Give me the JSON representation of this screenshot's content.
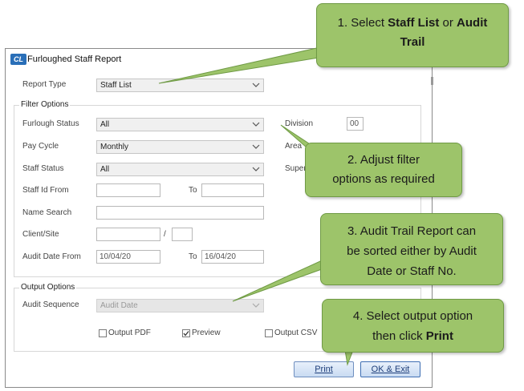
{
  "window": {
    "logo": "CL",
    "title": "Furloughed Staff Report"
  },
  "report_type": {
    "label": "Report Type",
    "value": "Staff List"
  },
  "filter_options": {
    "group_label": "Filter Options",
    "furlough_status": {
      "label": "Furlough Status",
      "value": "All"
    },
    "pay_cycle": {
      "label": "Pay Cycle",
      "value": "Monthly"
    },
    "staff_status": {
      "label": "Staff Status",
      "value": "All"
    },
    "staff_id_from": {
      "label": "Staff Id From",
      "value": ""
    },
    "staff_id_to": {
      "label": "To",
      "value": ""
    },
    "name_search": {
      "label": "Name Search",
      "value": ""
    },
    "client_site": {
      "label": "Client/Site",
      "value": "",
      "separator": "/",
      "site_value": ""
    },
    "audit_date_from": {
      "label": "Audit Date From",
      "value": "10/04/20"
    },
    "audit_date_to": {
      "label": "To",
      "value": "16/04/20"
    },
    "division": {
      "label": "Division",
      "value": "00"
    },
    "area": {
      "label": "Area"
    },
    "supervisor": {
      "label": "Super"
    }
  },
  "output_options": {
    "group_label": "Output Options",
    "audit_sequence": {
      "label": "Audit Sequence",
      "value": "Audit Date"
    },
    "output_pdf": {
      "label": "Output PDF",
      "checked": false
    },
    "preview": {
      "label": "Preview",
      "checked": true
    },
    "output_csv": {
      "label": "Output CSV",
      "checked": false
    }
  },
  "buttons": {
    "print": "Print",
    "ok_exit": "OK & Exit"
  },
  "callouts": {
    "c1": {
      "line1_pre": "1. Select ",
      "line1_b1": "Staff List",
      "line1_mid": " or ",
      "line1_b2": "Audit",
      "line2_b": "Trail"
    },
    "c2": {
      "line1": "2. Adjust filter",
      "line2": "options as required"
    },
    "c3": {
      "line1": "3. Audit Trail Report can",
      "line2": "be sorted either by Audit",
      "line3": "Date or Staff No."
    },
    "c4": {
      "line1": "4. Select output option",
      "line2_pre": "then click ",
      "line2_b": "Print"
    }
  },
  "colors": {
    "callout": "#9dc46a",
    "window_border": "#8a8a8a",
    "button": "#c9dbf2"
  }
}
